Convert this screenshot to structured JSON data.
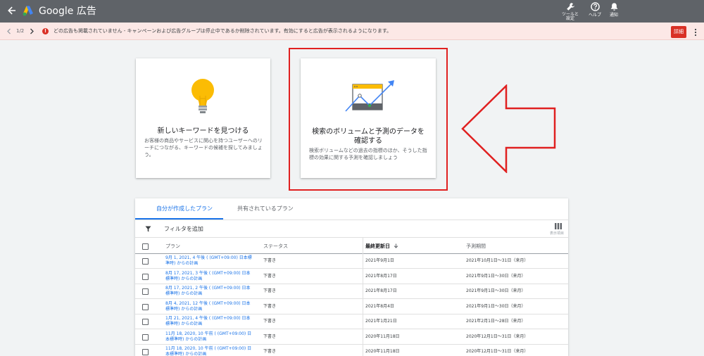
{
  "app": {
    "title": "Google 広告"
  },
  "topbar": {
    "tools_label": "ツールと\n設定",
    "help_label": "ヘルプ",
    "notifications_label": "通知"
  },
  "notice": {
    "counter": "1/2",
    "message": "どの広告も掲載されていません - キャンペーンおよび広告グループは停止中であるか削除されています。有効にすると広告が表示されるようになります。",
    "details_label": "詳細"
  },
  "cards": [
    {
      "title": "新しいキーワードを見つける",
      "description": "お客様の商品やサービスに関心を持つユーザーへのリーチにつながる、キーワードの候補を探してみましょう。"
    },
    {
      "title": "検索のボリュームと予測のデータを確認する",
      "description": "検索ボリュームなどの過去の指標のほか、そうした指標の効果に関する予測を確認しましょう"
    }
  ],
  "tabs": [
    {
      "label": "自分が作成したプラン"
    },
    {
      "label": "共有されているプラン"
    }
  ],
  "filter": {
    "label": "フィルタを追加",
    "columns_label": "表示項目"
  },
  "table": {
    "headers": {
      "plan": "プラン",
      "status": "ステータス",
      "last_updated": "最終更新日",
      "forecast_period": "予測期間"
    },
    "rows": [
      {
        "plan": "9月 1, 2021, 4 午後 ( (GMT+09:00) 日本標準時) からの計画",
        "status": "下書き",
        "updated": "2021年9月1日",
        "period": "2021年10月1日～31日（来月）"
      },
      {
        "plan": "8月 17, 2021, 3 午後 ( (GMT+09:00) 日本標準時) からの計画",
        "status": "下書き",
        "updated": "2021年8月17日",
        "period": "2021年9月1日～30日（来月）"
      },
      {
        "plan": "8月 17, 2021, 2 午後 ( (GMT+09:00) 日本標準時) からの計画",
        "status": "下書き",
        "updated": "2021年8月17日",
        "period": "2021年9月1日～30日（来月）"
      },
      {
        "plan": "8月 4, 2021, 12 午後 ( (GMT+09:00) 日本標準時) からの計画",
        "status": "下書き",
        "updated": "2021年8月4日",
        "period": "2021年9月1日～30日（来月）"
      },
      {
        "plan": "1月 21, 2021, 4 午後 ( (GMT+09:00) 日本標準時) からの計画",
        "status": "下書き",
        "updated": "2021年1月21日",
        "period": "2021年2月1日～28日（来月）"
      },
      {
        "plan": "11月 18, 2020, 10 午前 ( (GMT+09:00) 日本標準時) からの計画",
        "status": "下書き",
        "updated": "2020年11月18日",
        "period": "2020年12月1日～31日（来月）"
      },
      {
        "plan": "11月 18, 2020, 10 午前 ( (GMT+09:00) 日本標準時) からの計画",
        "status": "下書き",
        "updated": "2020年11月18日",
        "period": "2020年12月1日～31日（来月）"
      }
    ]
  },
  "colors": {
    "topbar": "#5f6368",
    "notice_bg": "#fce8e6",
    "error": "#d93025",
    "link": "#1a73e8",
    "highlight": "#e02020"
  }
}
